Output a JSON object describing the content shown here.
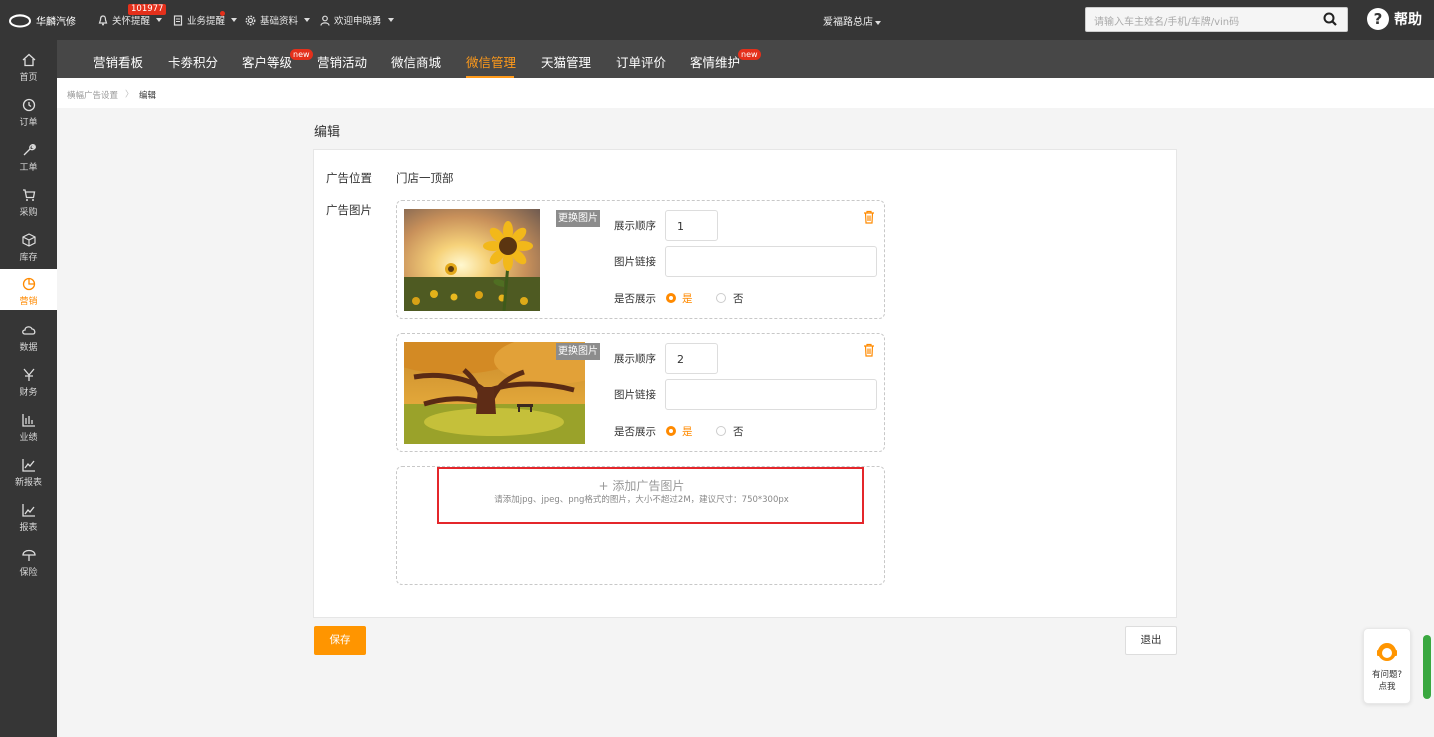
{
  "app": {
    "logo_text": "华麟汽修",
    "store_name": "爱福路总店"
  },
  "topnav": [
    {
      "label": "关怀提醒",
      "icon": "bell-icon"
    },
    {
      "label": "业务提醒",
      "icon": "document-icon"
    },
    {
      "label": "基础资料",
      "icon": "gear-icon"
    },
    {
      "label": "欢迎申晓勇",
      "icon": "user-icon"
    }
  ],
  "care_badge": "101977",
  "search": {
    "placeholder": "请输入车主姓名/手机/车牌/vin码"
  },
  "help_label": "帮助",
  "sidebar": [
    {
      "label": "首页",
      "icon": "home-icon"
    },
    {
      "label": "订单",
      "icon": "clock-icon"
    },
    {
      "label": "工单",
      "icon": "wrench-icon"
    },
    {
      "label": "采购",
      "icon": "cart-icon"
    },
    {
      "label": "库存",
      "icon": "box-icon"
    },
    {
      "label": "营销",
      "icon": "pie-chart-icon",
      "active": true
    },
    {
      "label": "数据",
      "icon": "cloud-icon"
    },
    {
      "label": "财务",
      "icon": "yen-icon"
    },
    {
      "label": "业绩",
      "icon": "bar-chart-icon"
    },
    {
      "label": "新报表",
      "icon": "line-chart-icon"
    },
    {
      "label": "报表",
      "icon": "report-chart-icon"
    },
    {
      "label": "保险",
      "icon": "umbrella-icon"
    }
  ],
  "tabs": [
    {
      "label": "营销看板"
    },
    {
      "label": "卡劵积分"
    },
    {
      "label": "客户等级",
      "new": "new"
    },
    {
      "label": "营销活动"
    },
    {
      "label": "微信商城"
    },
    {
      "label": "微信管理",
      "active": true
    },
    {
      "label": "天猫管理"
    },
    {
      "label": "订单评价"
    },
    {
      "label": "客情维护",
      "new": "new"
    }
  ],
  "breadcrumb": {
    "parent": "横幅广告设置",
    "current": "编辑"
  },
  "page_title": "编辑",
  "form": {
    "position_label": "广告位置",
    "position_value": "门店一顶部",
    "images_label": "广告图片",
    "change_image_label": "更换图片",
    "order_label": "展示顺序",
    "link_label": "图片链接",
    "show_label": "是否展示",
    "yes_label": "是",
    "no_label": "否",
    "ads": [
      {
        "order": "1",
        "link": "",
        "show": true,
        "image": "sunflower"
      },
      {
        "order": "2",
        "link": "",
        "show": true,
        "image": "autumn-tree"
      }
    ],
    "add_label": "添加广告图片",
    "add_hint": "请添加jpg、jpeg、png格式的图片，大小不超过2M，建议尺寸：750*300px"
  },
  "buttons": {
    "save": "保存",
    "exit": "退出"
  },
  "chat": {
    "line1": "有问题?",
    "line2": "点我"
  },
  "colors": {
    "accent": "#ff9500",
    "topbar": "#363636",
    "subnav": "#474747",
    "badge": "#e4301b"
  }
}
